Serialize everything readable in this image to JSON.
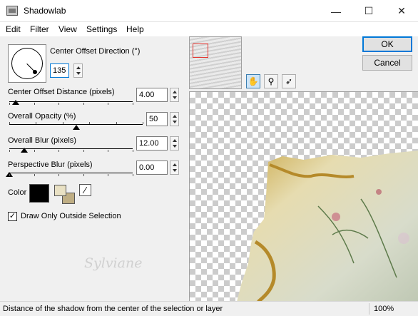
{
  "window": {
    "title": "Shadowlab",
    "minimize": "—",
    "maximize": "☐",
    "close": "✕"
  },
  "menu": [
    "Edit",
    "Filter",
    "View",
    "Settings",
    "Help"
  ],
  "controls": {
    "direction": {
      "label": "Center Offset Direction (°)",
      "value": "135"
    },
    "distance": {
      "label": "Center Offset Distance (pixels)",
      "value": "4.00",
      "level": 0.05
    },
    "opacity": {
      "label": "Overall Opacity (%)",
      "value": "50",
      "level": 0.5
    },
    "blur": {
      "label": "Overall Blur (pixels)",
      "value": "12.00",
      "level": 0.12
    },
    "perspective_blur": {
      "label": "Perspective Blur (pixels)",
      "value": "0.00",
      "level": 0.0
    },
    "color": {
      "label": "Color",
      "primary": "#000000",
      "secondary": "#e9e1c4",
      "secondary_back": "#bfae84"
    },
    "draw_outside": {
      "label": "Draw Only Outside Selection",
      "checked": true
    }
  },
  "tools": [
    "hand-tool",
    "zoom-tool",
    "pointer-tool"
  ],
  "buttons": {
    "ok": "OK",
    "cancel": "Cancel"
  },
  "watermark": "Sylviane",
  "status": {
    "text": "Distance of the shadow from the center of the selection or layer",
    "zoom": "100%"
  }
}
